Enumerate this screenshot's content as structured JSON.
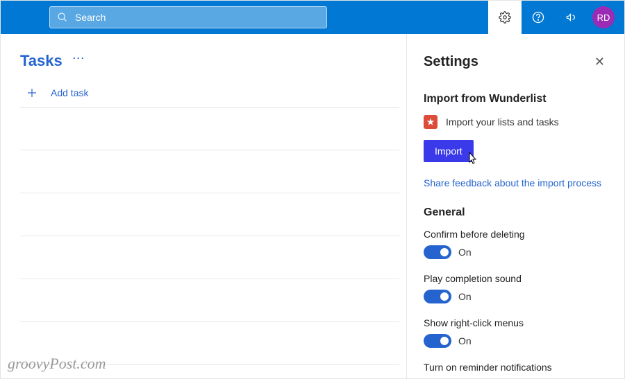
{
  "header": {
    "search_placeholder": "Search",
    "avatar_initials": "RD"
  },
  "list": {
    "title": "Tasks",
    "add_task_label": "Add task"
  },
  "settings": {
    "title": "Settings",
    "import": {
      "section_title": "Import from Wunderlist",
      "description": "Import your lists and tasks",
      "button_label": "Import",
      "feedback_link": "Share feedback about the import process"
    },
    "general": {
      "section_title": "General",
      "items": [
        {
          "label": "Confirm before deleting",
          "state": "On"
        },
        {
          "label": "Play completion sound",
          "state": "On"
        },
        {
          "label": "Show right-click menus",
          "state": "On"
        },
        {
          "label": "Turn on reminder notifications",
          "state": ""
        }
      ]
    }
  },
  "watermark": "groovyPost.com"
}
